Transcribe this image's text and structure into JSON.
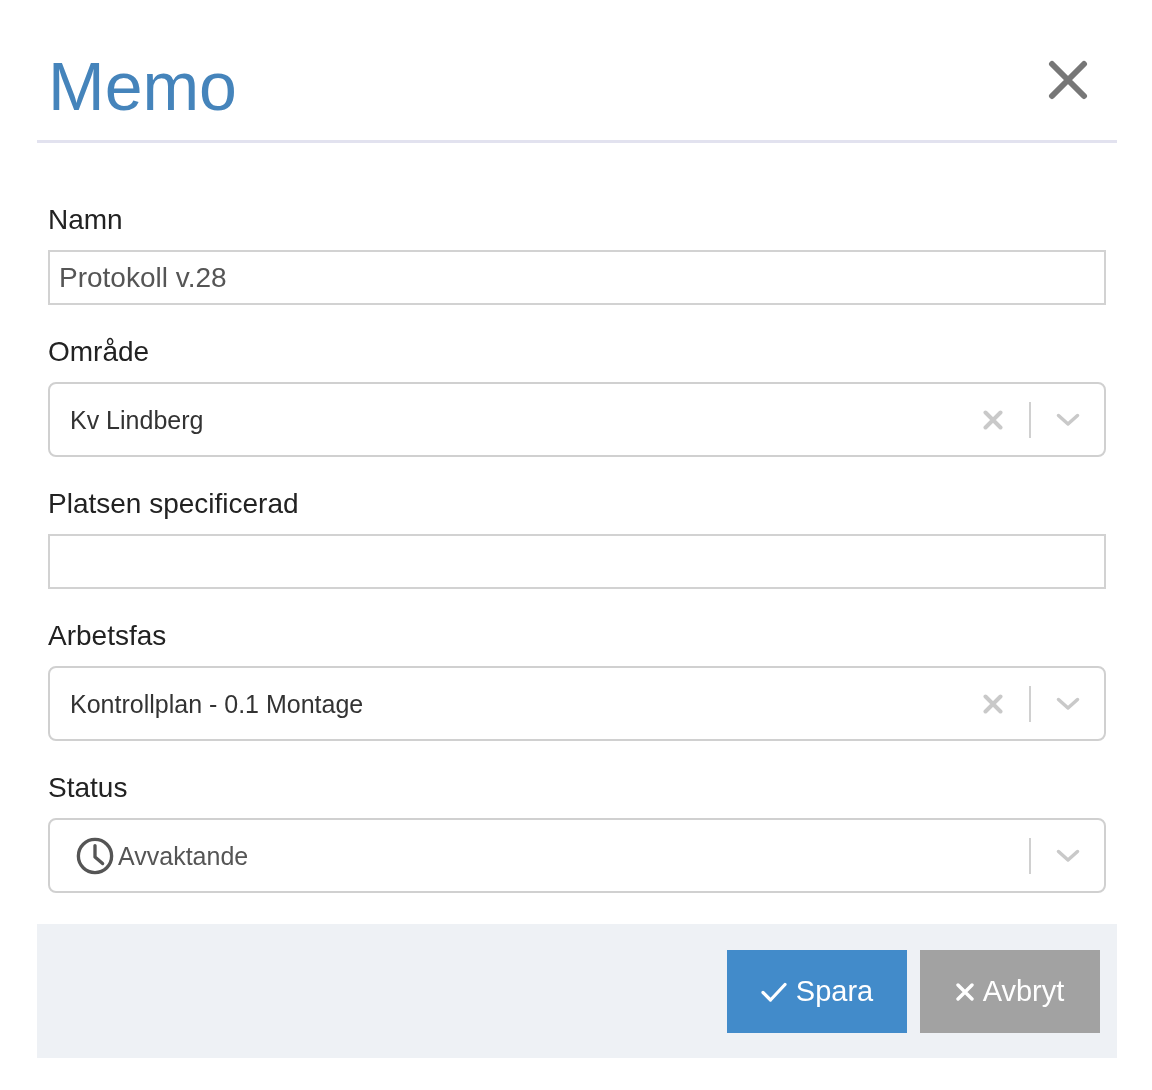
{
  "dialog": {
    "title": "Memo"
  },
  "fields": [
    {
      "kind": "text",
      "label": "Namn",
      "value": "Protokoll v.28"
    },
    {
      "kind": "select",
      "label": "Område",
      "value": "Kv Lindberg",
      "clearable": true
    },
    {
      "kind": "text",
      "label": "Platsen specificerad"
    },
    {
      "kind": "select",
      "label": "Arbetsfas",
      "value": "Kontrollplan - 0.1 Montage",
      "clearable": true
    },
    {
      "kind": "status",
      "label": "Status",
      "value": "Avvaktande",
      "clearable": false
    }
  ],
  "buttons": [
    {
      "kind": "primary",
      "label": "Spara"
    },
    {
      "kind": "secondary",
      "label": "Avbryt"
    }
  ]
}
